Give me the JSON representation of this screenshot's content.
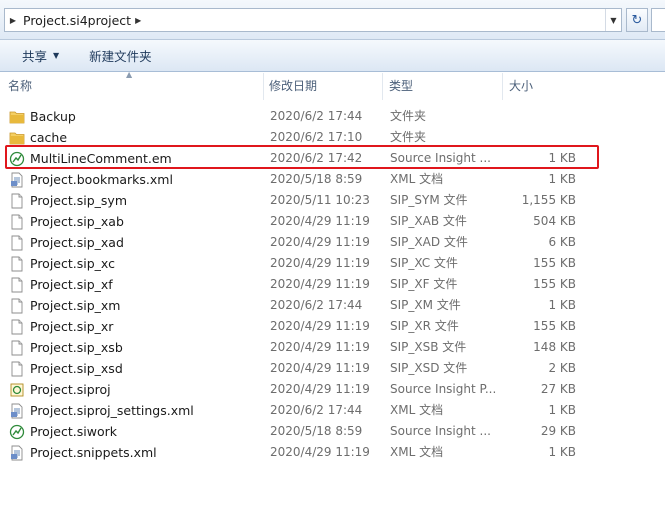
{
  "address": {
    "crumbs": [
      "Project.si4project"
    ]
  },
  "toolbar": {
    "share_label": "共享",
    "newfolder_label": "新建文件夹"
  },
  "columns": {
    "name": "名称",
    "date": "修改日期",
    "type": "类型",
    "size": "大小"
  },
  "files": [
    {
      "name": "Backup",
      "date": "2020/6/2 17:44",
      "type": "文件夹",
      "size": "",
      "icon": "folder-icon"
    },
    {
      "name": "cache",
      "date": "2020/6/2 17:10",
      "type": "文件夹",
      "size": "",
      "icon": "folder-icon"
    },
    {
      "name": "MultiLineComment.em",
      "date": "2020/6/2 17:42",
      "type": "Source Insight ...",
      "size": "1 KB",
      "icon": "source-insight-icon",
      "highlighted": true
    },
    {
      "name": "Project.bookmarks.xml",
      "date": "2020/5/18 8:59",
      "type": "XML 文档",
      "size": "1 KB",
      "icon": "xml-icon"
    },
    {
      "name": "Project.sip_sym",
      "date": "2020/5/11 10:23",
      "type": "SIP_SYM 文件",
      "size": "1,155 KB",
      "icon": "file-icon"
    },
    {
      "name": "Project.sip_xab",
      "date": "2020/4/29 11:19",
      "type": "SIP_XAB 文件",
      "size": "504 KB",
      "icon": "file-icon"
    },
    {
      "name": "Project.sip_xad",
      "date": "2020/4/29 11:19",
      "type": "SIP_XAD 文件",
      "size": "6 KB",
      "icon": "file-icon"
    },
    {
      "name": "Project.sip_xc",
      "date": "2020/4/29 11:19",
      "type": "SIP_XC 文件",
      "size": "155 KB",
      "icon": "file-icon"
    },
    {
      "name": "Project.sip_xf",
      "date": "2020/4/29 11:19",
      "type": "SIP_XF 文件",
      "size": "155 KB",
      "icon": "file-icon"
    },
    {
      "name": "Project.sip_xm",
      "date": "2020/6/2 17:44",
      "type": "SIP_XM 文件",
      "size": "1 KB",
      "icon": "file-icon"
    },
    {
      "name": "Project.sip_xr",
      "date": "2020/4/29 11:19",
      "type": "SIP_XR 文件",
      "size": "155 KB",
      "icon": "file-icon"
    },
    {
      "name": "Project.sip_xsb",
      "date": "2020/4/29 11:19",
      "type": "SIP_XSB 文件",
      "size": "148 KB",
      "icon": "file-icon"
    },
    {
      "name": "Project.sip_xsd",
      "date": "2020/4/29 11:19",
      "type": "SIP_XSD 文件",
      "size": "2 KB",
      "icon": "file-icon"
    },
    {
      "name": "Project.siproj",
      "date": "2020/4/29 11:19",
      "type": "Source Insight P...",
      "size": "27 KB",
      "icon": "siproj-icon"
    },
    {
      "name": "Project.siproj_settings.xml",
      "date": "2020/6/2 17:44",
      "type": "XML 文档",
      "size": "1 KB",
      "icon": "xml-icon"
    },
    {
      "name": "Project.siwork",
      "date": "2020/5/18 8:59",
      "type": "Source Insight ...",
      "size": "29 KB",
      "icon": "source-insight-icon"
    },
    {
      "name": "Project.snippets.xml",
      "date": "2020/4/29 11:19",
      "type": "XML 文档",
      "size": "1 KB",
      "icon": "xml-icon"
    }
  ],
  "colors": {
    "highlight_border": "#e0161c",
    "folder": "#e8b93c",
    "toolbar_text": "#1e395b"
  }
}
